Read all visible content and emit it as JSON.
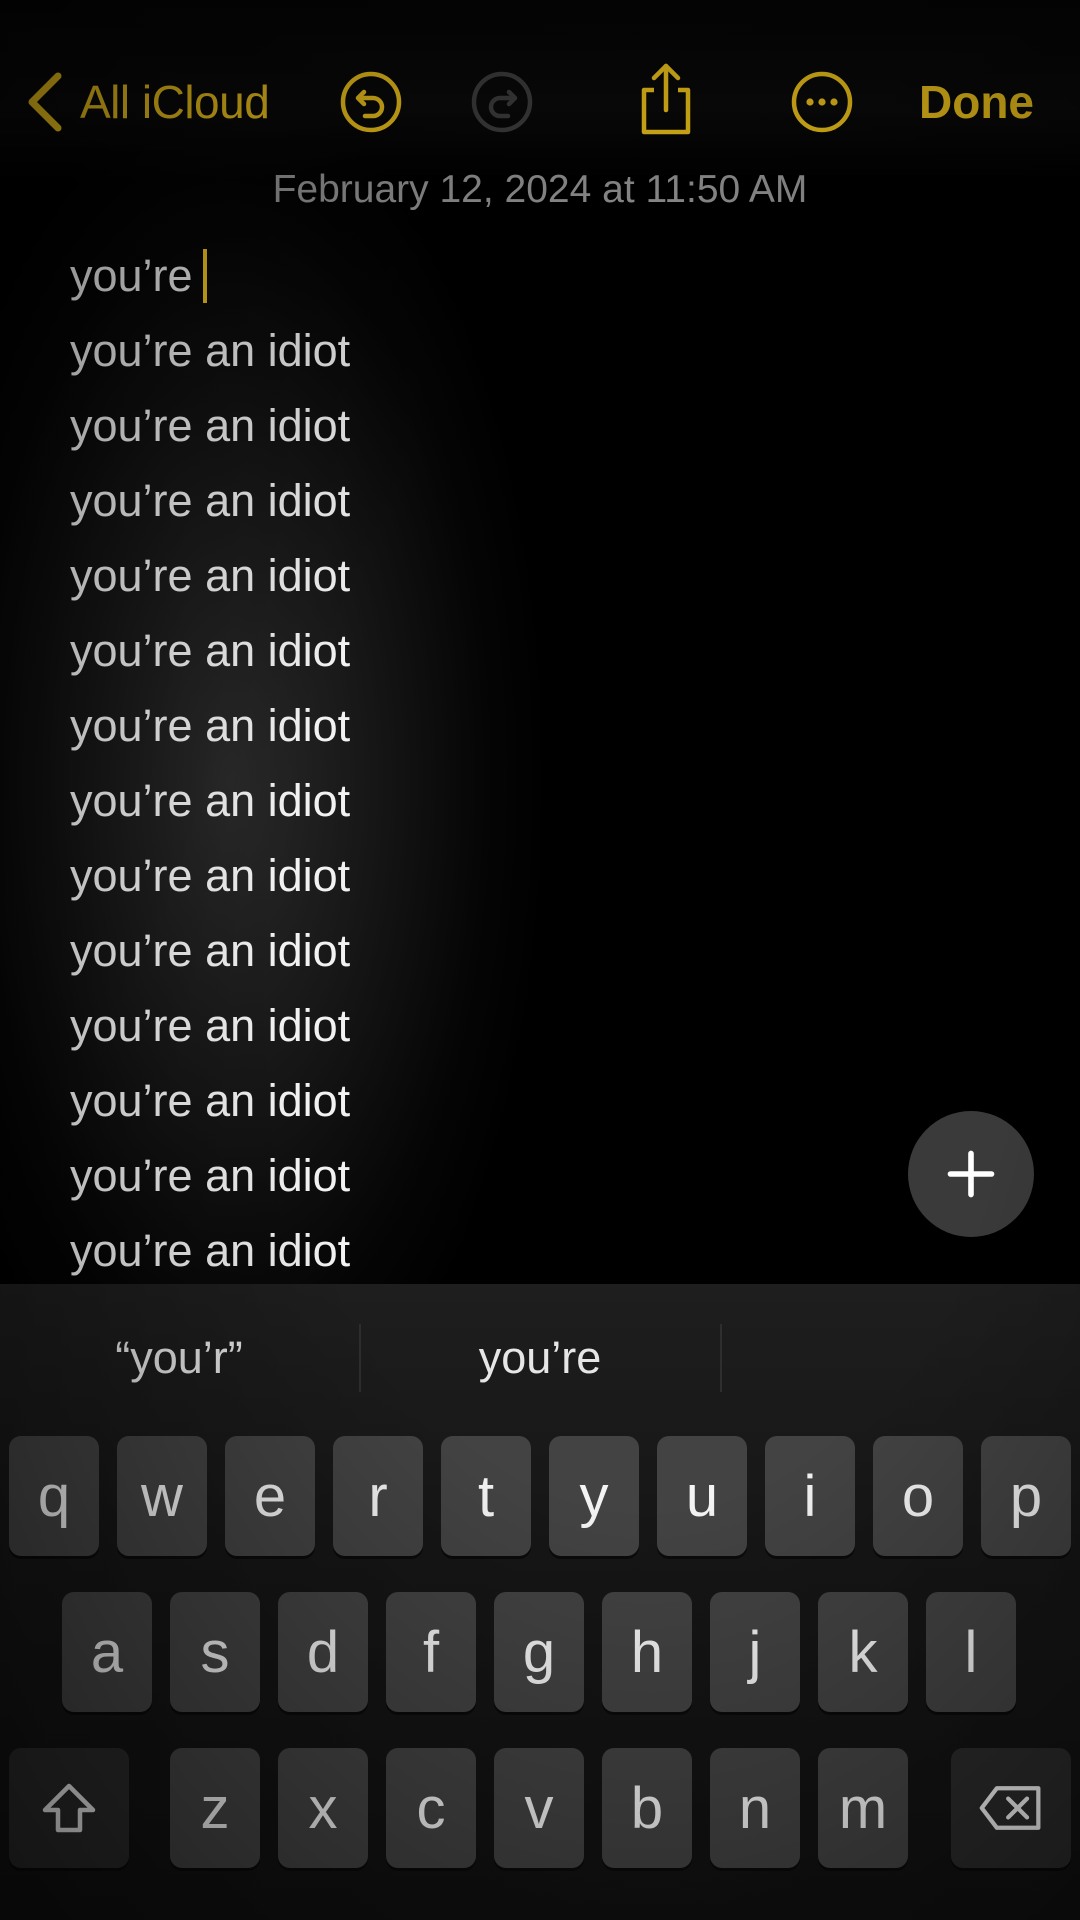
{
  "colors": {
    "accent": "#f3c61b",
    "background": "#000000",
    "key": "#434343",
    "function_key": "#2b2b2b",
    "note_text": "#f2f2f2",
    "date_text": "#9a9a9a"
  },
  "toolbar": {
    "back_label": "All iCloud",
    "back_icon": "chevron-left-icon",
    "undo_icon": "undo-icon",
    "redo_icon": "redo-icon",
    "redo_enabled": false,
    "share_icon": "share-icon",
    "more_icon": "ellipsis-circle-icon",
    "done_label": "Done"
  },
  "note": {
    "date": "February 12, 2024 at 11:50 AM",
    "lines": [
      "you’re",
      "you’re an idiot",
      "you’re an idiot",
      "you’re an idiot",
      "you’re an idiot",
      "you’re an idiot",
      "you’re an idiot",
      "you’re an idiot",
      "you’re an idiot",
      "you’re an idiot",
      "you’re an idiot",
      "you’re an idiot",
      "you’re an idiot",
      "you’re an idiot"
    ]
  },
  "add_button": {
    "icon": "plus-icon"
  },
  "keyboard": {
    "suggestions": [
      "“you’r”",
      "you’re",
      ""
    ],
    "rows": [
      [
        "q",
        "w",
        "e",
        "r",
        "t",
        "y",
        "u",
        "i",
        "o",
        "p"
      ],
      [
        "a",
        "s",
        "d",
        "f",
        "g",
        "h",
        "j",
        "k",
        "l"
      ],
      [
        "z",
        "x",
        "c",
        "v",
        "b",
        "n",
        "m"
      ]
    ],
    "shift_icon": "shift-icon",
    "delete_icon": "delete-backspace-icon"
  }
}
